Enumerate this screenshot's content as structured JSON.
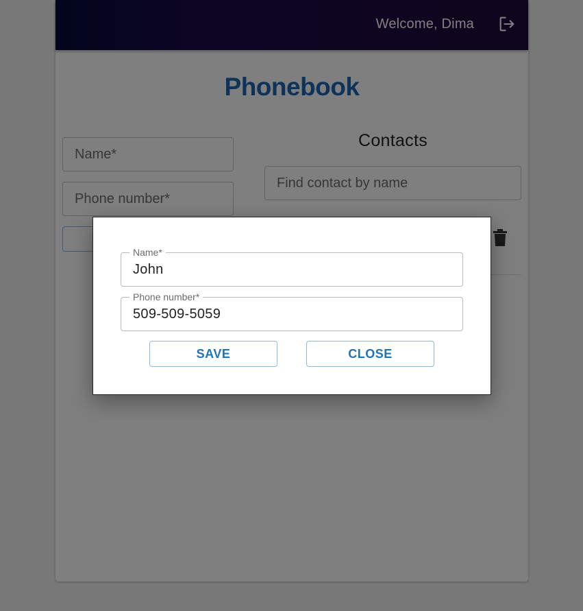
{
  "header": {
    "welcome_text": "Welcome, Dima",
    "logout_icon": "logout-icon"
  },
  "page": {
    "title": "Phonebook"
  },
  "add_form": {
    "name_placeholder": "Name*",
    "phone_placeholder": "Phone number*"
  },
  "contacts": {
    "title": "Contacts",
    "search_placeholder": "Find contact by name",
    "delete_icon": "trash-icon"
  },
  "edit_modal": {
    "name_label": "Name*",
    "name_value": "John",
    "phone_label": "Phone number*",
    "phone_value": "509-509-5059",
    "save_label": "SAVE",
    "close_label": "CLOSE"
  },
  "colors": {
    "title": "#1f65b3",
    "button_text": "#1f74b9",
    "appbar_start": "#050a3a",
    "appbar_end": "#210a3c"
  }
}
